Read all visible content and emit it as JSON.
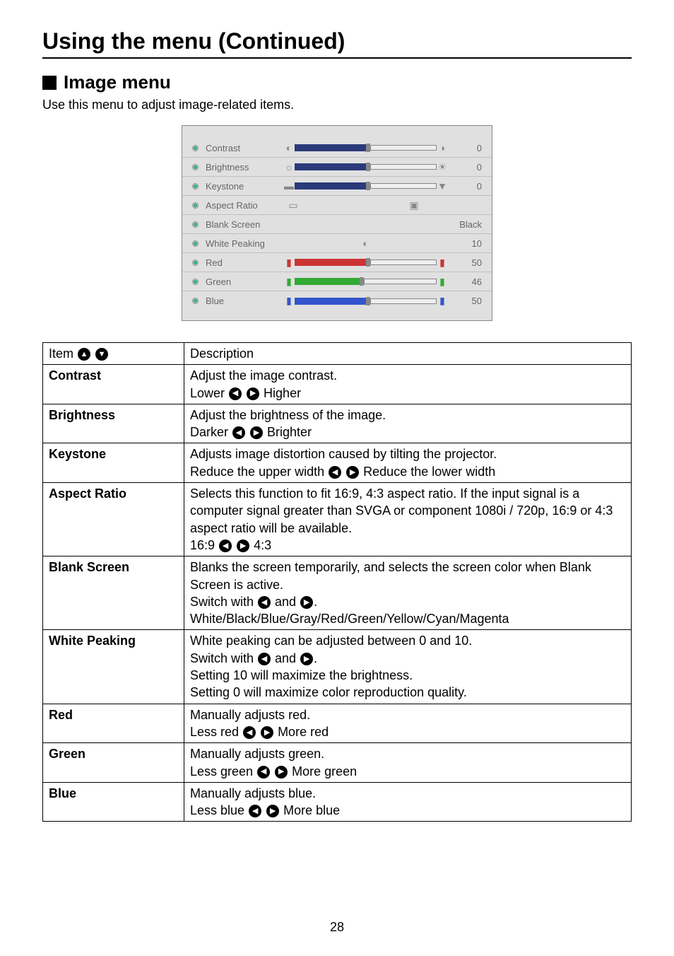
{
  "page": {
    "title": "Using the menu (Continued)",
    "section_title": "Image menu",
    "section_desc": "Use this menu to adjust image-related items.",
    "page_number": "28"
  },
  "menu": {
    "rows": [
      {
        "label": "Contrast",
        "value": "0",
        "fill": 50
      },
      {
        "label": "Brightness",
        "value": "0",
        "fill": 50
      },
      {
        "label": "Keystone",
        "value": "0",
        "fill": 50
      },
      {
        "label": "Aspect Ratio",
        "value": ""
      },
      {
        "label": "Blank Screen",
        "value": "Black"
      },
      {
        "label": "White Peaking",
        "value": "10"
      },
      {
        "label": "Red",
        "value": "50",
        "fill": 50,
        "color": "#c33"
      },
      {
        "label": "Green",
        "value": "46",
        "fill": 46,
        "color": "#3a3"
      },
      {
        "label": "Blue",
        "value": "50",
        "fill": 50,
        "color": "#35c"
      }
    ]
  },
  "table": {
    "header_item": "Item",
    "header_desc": "Description",
    "rows": [
      {
        "item": "Contrast",
        "lines": [
          "Adjust the image contrast.",
          "Lower ◀▶ Higher"
        ]
      },
      {
        "item": "Brightness",
        "lines": [
          "Adjust the brightness of the image.",
          "Darker ◀▶ Brighter"
        ]
      },
      {
        "item": "Keystone",
        "lines": [
          "Adjusts image distortion caused by tilting the projector.",
          "Reduce the upper width ◀▶ Reduce the lower width"
        ]
      },
      {
        "item": "Aspect Ratio",
        "lines": [
          "Selects this function to fit 16:9, 4:3 aspect ratio. If the input signal is a computer signal greater than SVGA or component 1080i / 720p, 16:9 or 4:3 aspect ratio will be available.",
          "16:9 ◀▶ 4:3"
        ]
      },
      {
        "item": "Blank Screen",
        "lines": [
          "Blanks the screen temporarily, and selects the screen color when Blank Screen is active.",
          "Switch with ◀ and ▶.",
          "White/Black/Blue/Gray/Red/Green/Yellow/Cyan/Magenta"
        ]
      },
      {
        "item": "White Peaking",
        "lines": [
          "White peaking can be adjusted between 0 and 10.",
          "Switch with ◀ and ▶.",
          "Setting 10 will maximize the brightness.",
          "Setting 0 will maximize color reproduction quality."
        ]
      },
      {
        "item": "Red",
        "lines": [
          "Manually adjusts red.",
          "Less red ◀▶ More red"
        ]
      },
      {
        "item": "Green",
        "lines": [
          "Manually adjusts green.",
          "Less green ◀▶ More green"
        ]
      },
      {
        "item": "Blue",
        "lines": [
          "Manually adjusts blue.",
          "Less blue ◀▶ More blue"
        ]
      }
    ]
  }
}
